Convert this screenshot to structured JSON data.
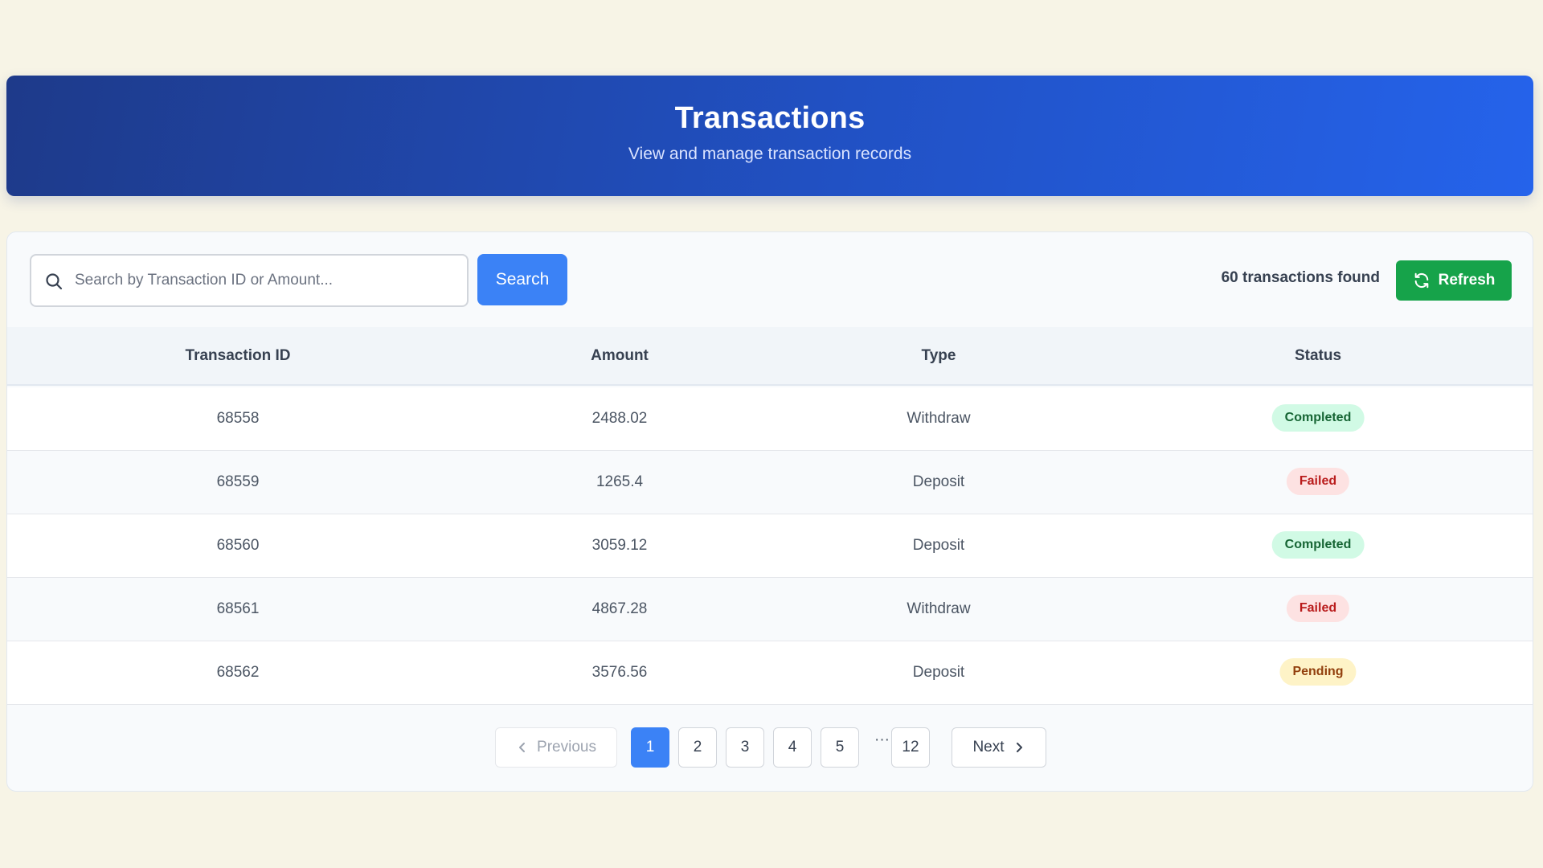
{
  "header": {
    "title": "Transactions",
    "subtitle": "View and manage transaction records"
  },
  "toolbar": {
    "search_placeholder": "Search by Transaction ID or Amount...",
    "search_value": "",
    "search_label": "Search",
    "count_text": "60 transactions found",
    "refresh_label": "Refresh"
  },
  "table": {
    "columns": [
      "Transaction ID",
      "Amount",
      "Type",
      "Status"
    ],
    "rows": [
      {
        "id": "68558",
        "amount": "2488.02",
        "type": "Withdraw",
        "status": "Completed"
      },
      {
        "id": "68559",
        "amount": "1265.4",
        "type": "Deposit",
        "status": "Failed"
      },
      {
        "id": "68560",
        "amount": "3059.12",
        "type": "Deposit",
        "status": "Completed"
      },
      {
        "id": "68561",
        "amount": "4867.28",
        "type": "Withdraw",
        "status": "Failed"
      },
      {
        "id": "68562",
        "amount": "3576.56",
        "type": "Deposit",
        "status": "Pending"
      }
    ]
  },
  "pagination": {
    "previous_label": "Previous",
    "next_label": "Next",
    "pages": [
      "1",
      "2",
      "3",
      "4",
      "5"
    ],
    "ellipsis": "···",
    "last_page": "12",
    "current_page": "1"
  },
  "colors": {
    "page_background": "#f7f4e6",
    "header_gradient_start": "#1e3a8a",
    "header_gradient_end": "#2563eb",
    "primary": "#3b82f6",
    "success": "#16a34a",
    "completed_badge": "#d1fae5",
    "failed_badge": "#fde2e2",
    "pending_badge": "#fef3c7"
  },
  "icons": {
    "search": "search-icon",
    "refresh": "refresh-icon",
    "previous": "chevron-left-icon",
    "next": "chevron-right-icon"
  }
}
